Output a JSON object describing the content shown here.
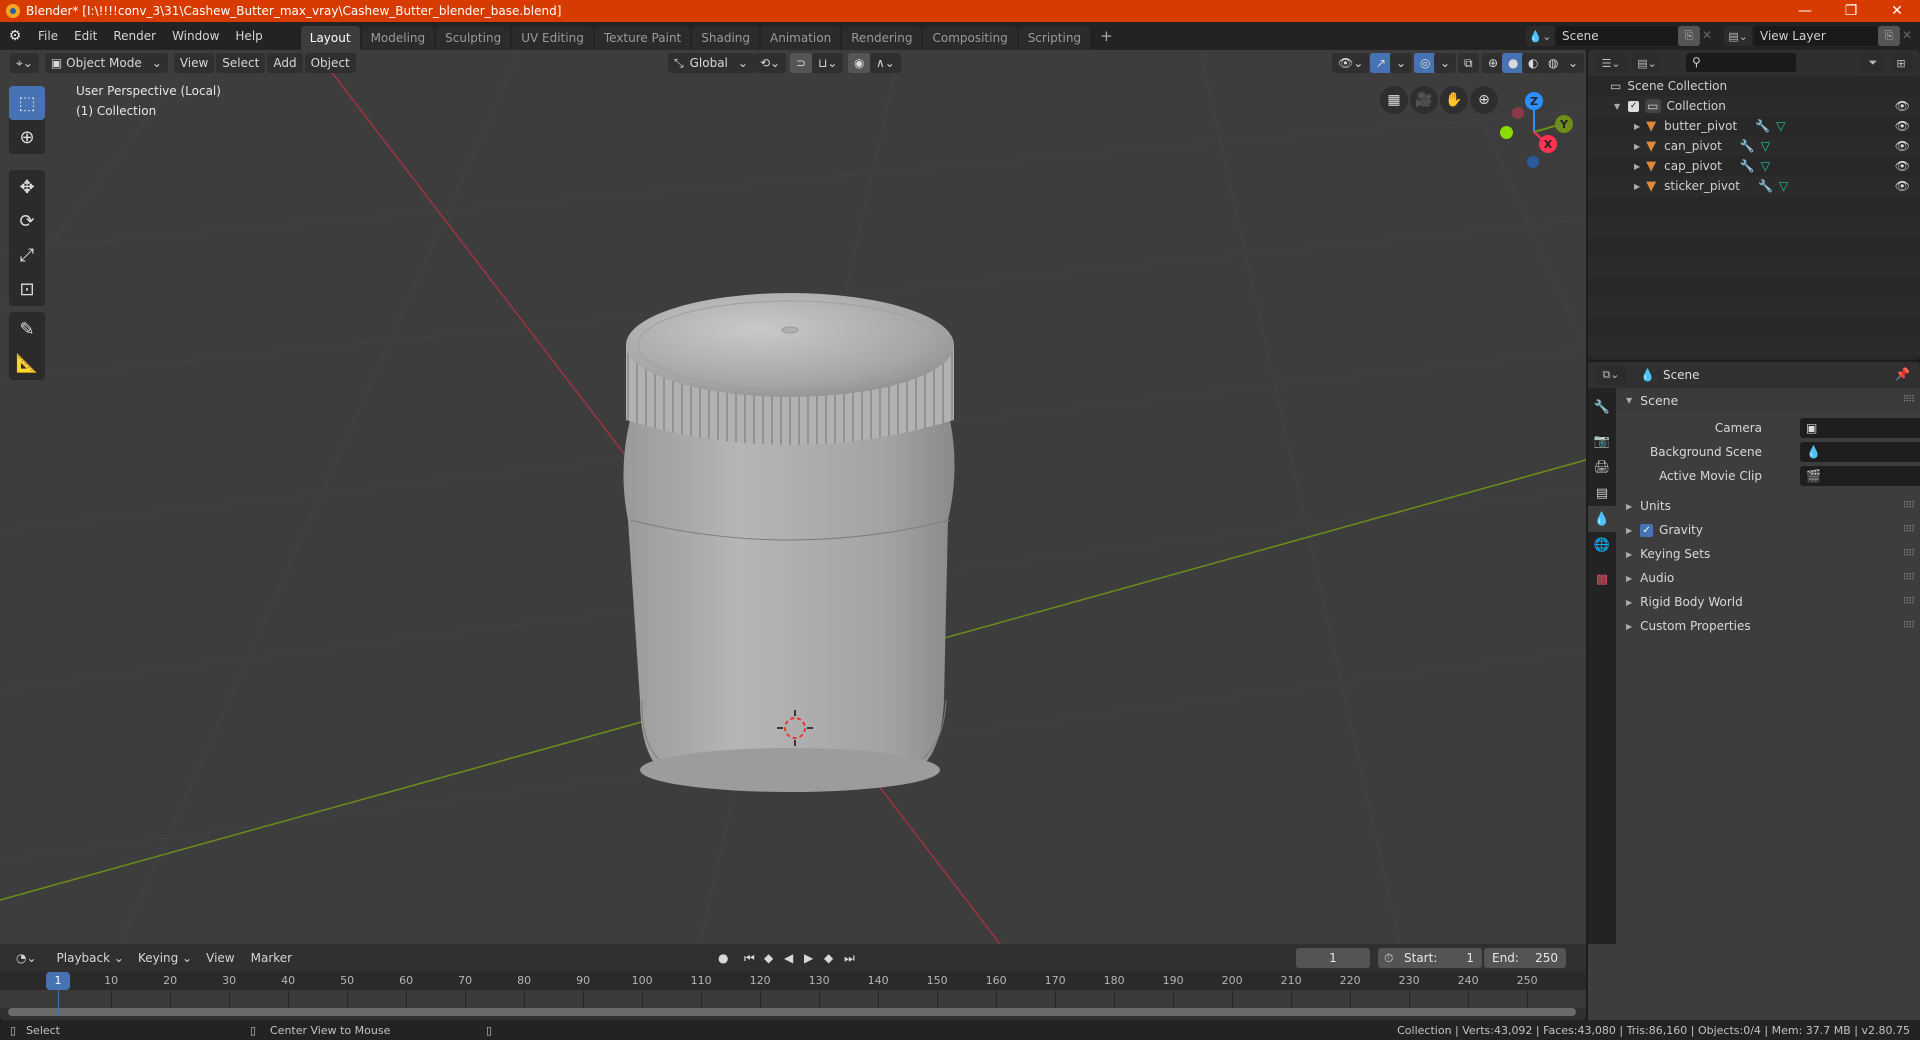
{
  "window": {
    "title": "Blender* [I:\\!!!!conv_3\\31\\Cashew_Butter_max_vray\\Cashew_Butter_blender_base.blend]",
    "controls": {
      "minimize": "—",
      "maximize": "❐",
      "close": "✕"
    }
  },
  "menu": [
    "File",
    "Edit",
    "Render",
    "Window",
    "Help"
  ],
  "workspaces": [
    {
      "label": "Layout",
      "active": true
    },
    {
      "label": "Modeling"
    },
    {
      "label": "Sculpting"
    },
    {
      "label": "UV Editing"
    },
    {
      "label": "Texture Paint"
    },
    {
      "label": "Shading"
    },
    {
      "label": "Animation"
    },
    {
      "label": "Rendering"
    },
    {
      "label": "Compositing"
    },
    {
      "label": "Scripting"
    }
  ],
  "add_workspace": "+",
  "scene_selector": {
    "value": "Scene"
  },
  "view_layer_selector": {
    "value": "View Layer"
  },
  "viewport": {
    "mode": "Object Mode",
    "menus": [
      "View",
      "Select",
      "Add",
      "Object"
    ],
    "transform_orientation": "Global",
    "overlay_text": {
      "line1": "User Perspective (Local)",
      "line2": "(1) Collection"
    },
    "gizmo_axes": {
      "z": "Z",
      "y": "Y",
      "x": "X"
    },
    "colors": {
      "x_axis": "#ff3352",
      "y_axis": "#8bdc00",
      "z_axis": "#2c8fff",
      "active_tool": "#4772b3",
      "bg": "#3d3d3d"
    }
  },
  "outliner": {
    "search_placeholder": "",
    "root": "Scene Collection",
    "collection": "Collection",
    "objects": [
      {
        "name": "butter_pivot"
      },
      {
        "name": "can_pivot"
      },
      {
        "name": "cap_pivot"
      },
      {
        "name": "sticker_pivot"
      }
    ]
  },
  "properties": {
    "context": "Scene",
    "panel_title": "Scene",
    "fields": [
      {
        "label": "Camera",
        "value": ""
      },
      {
        "label": "Background Scene",
        "value": ""
      },
      {
        "label": "Active Movie Clip",
        "value": ""
      }
    ],
    "sections": [
      {
        "label": "Units"
      },
      {
        "label": "Gravity",
        "checkbox": true
      },
      {
        "label": "Keying Sets"
      },
      {
        "label": "Audio"
      },
      {
        "label": "Rigid Body World"
      },
      {
        "label": "Custom Properties"
      }
    ]
  },
  "timeline": {
    "menus": [
      "Playback",
      "Keying",
      "View",
      "Marker"
    ],
    "current_frame": "1",
    "start_label": "Start:",
    "start": "1",
    "end_label": "End:",
    "end": "250",
    "ticks": [
      "10",
      "20",
      "30",
      "40",
      "50",
      "60",
      "70",
      "80",
      "90",
      "100",
      "110",
      "120",
      "130",
      "140",
      "150",
      "160",
      "170",
      "180",
      "190",
      "200",
      "210",
      "220",
      "230",
      "240",
      "250"
    ],
    "playhead": "1"
  },
  "statusbar": {
    "left_action": "Select",
    "middle_action": "Center View to Mouse",
    "stats": "Collection | Verts:43,092 | Faces:43,080 | Tris:86,160 | Objects:0/4 | Mem: 37.7 MB | v2.80.75"
  }
}
